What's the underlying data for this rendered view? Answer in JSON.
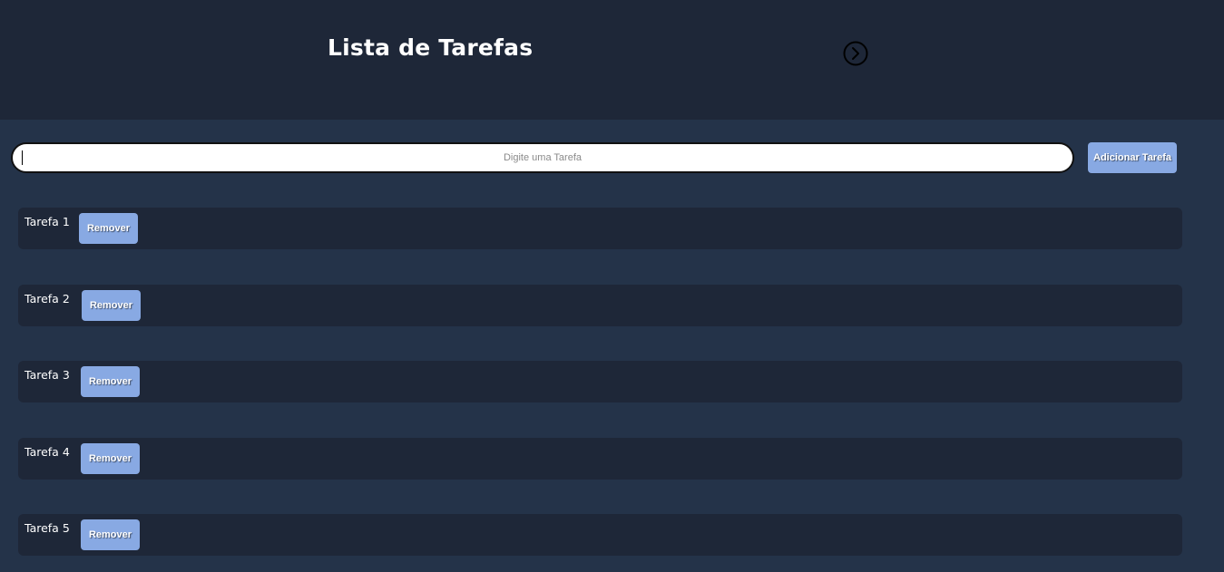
{
  "header": {
    "title": "Lista de Tarefas",
    "next_icon": "chevron-right-circle-icon"
  },
  "form": {
    "placeholder": "Digite uma Tarefa",
    "value": "",
    "add_label": "Adicionar Tarefa"
  },
  "tasks": [
    {
      "label": "Tarefa 1",
      "remove_label": "Remover"
    },
    {
      "label": "Tarefa 2",
      "remove_label": "Remover"
    },
    {
      "label": "Tarefa 3",
      "remove_label": "Remover"
    },
    {
      "label": "Tarefa 4",
      "remove_label": "Remover"
    },
    {
      "label": "Tarefa 5",
      "remove_label": "Remover"
    }
  ],
  "colors": {
    "header_bg": "#1e2738",
    "page_bg": "#243349",
    "button_bg": "#88a9e3"
  }
}
